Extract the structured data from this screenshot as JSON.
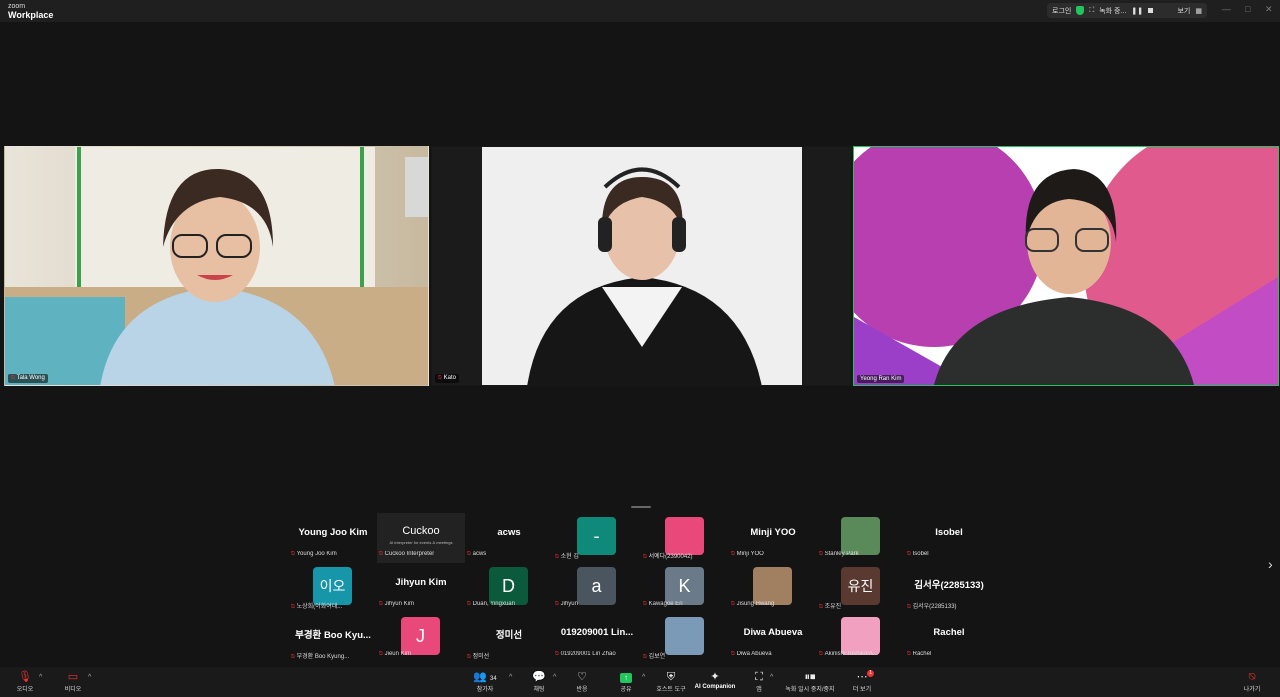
{
  "app": {
    "brand_small": "zoom",
    "brand_main": "Workplace"
  },
  "topbar": {
    "login": "로그인",
    "recording": "녹화 중...",
    "view": "보기"
  },
  "tiles": [
    {
      "name": "Tala Wong"
    },
    {
      "name": "Kato"
    },
    {
      "name": "Yeong Ran Kim"
    }
  ],
  "gallery": [
    {
      "display": "Young Joo Kim",
      "tag": "Young Joo Kim"
    },
    {
      "display": "Cuckoo",
      "tag": "Cuckoo Interpreter",
      "sub": "AI interpreter for events & meetings"
    },
    {
      "display": "acws",
      "tag": "acws"
    },
    {
      "avatar": "-",
      "color": "#0f8a7a",
      "tag": "소현 김"
    },
    {
      "avatar": "",
      "color": "#e8497a",
      "tag": "서예다(2390042)"
    },
    {
      "display": "Minji YOO",
      "tag": "Minji YOO"
    },
    {
      "avatar": "",
      "color": "#5a8a5a",
      "tag": "Stanley Park"
    },
    {
      "display": "Isobel",
      "tag": "Isobel"
    },
    {
      "avatar": "이오",
      "color": "#1696a8",
      "tag": "노상희(이화여대..."
    },
    {
      "display": "Jihyun Kim",
      "tag": "Jihyun Kim"
    },
    {
      "avatar": "D",
      "color": "#0c5a3c",
      "tag": "Duan, Yingxuan"
    },
    {
      "avatar": "a",
      "color": "#4a5560",
      "tag": "Jihyun"
    },
    {
      "avatar": "K",
      "color": "#6a7a88",
      "tag": "Kawagoe Eri"
    },
    {
      "avatar": "",
      "color": "#a08060",
      "tag": "Jisung Hwang"
    },
    {
      "avatar": "유진",
      "color": "#5a3a30",
      "tag": "조유진"
    },
    {
      "display": "김서우(2285133)",
      "tag": "김서우(2285133)"
    },
    {
      "display": "부경환 Boo Kyu...",
      "tag": "부경환 Boo Kyung..."
    },
    {
      "avatar": "J",
      "color": "#e8497a",
      "tag": "Jieun Kim"
    },
    {
      "display": "정미선",
      "tag": "정미선"
    },
    {
      "display": "019209001 Lin...",
      "tag": "019209001 Lin Zhao"
    },
    {
      "avatar": "",
      "color": "#7a9ab8",
      "tag": "김보연"
    },
    {
      "display": "Diwa Abueva",
      "tag": "Diwa Abueva"
    },
    {
      "avatar": "",
      "color": "#f2a0c0",
      "tag": "Akinishi Toshiko/A..."
    },
    {
      "display": "Rachel",
      "tag": "Rachel"
    }
  ],
  "toolbar": {
    "audio": "오디오",
    "video": "비디오",
    "participants": "참가자",
    "participants_count": "34",
    "chat": "채팅",
    "react": "반응",
    "share": "공유",
    "host_tools": "호스트 도구",
    "ai_companion": "AI Companion",
    "apps": "앱",
    "recording": "녹화 일시 중지/중지",
    "more": "더 보기",
    "more_badge": "1",
    "leave": "나가기"
  },
  "icons": {
    "audio": "mic-muted-icon",
    "video": "camera-off-icon",
    "participants": "people-icon",
    "chat": "chat-icon",
    "react": "heart-icon",
    "share": "share-screen-icon",
    "host_tools": "shield-icon",
    "ai_companion": "sparkle-icon",
    "apps": "apps-icon",
    "recording": "pause-stop-icon",
    "more": "more-icon",
    "leave": "leave-icon"
  },
  "colors": {
    "active_speaker": "#22c55e",
    "mute": "#e33333",
    "share": "#22c55e"
  }
}
